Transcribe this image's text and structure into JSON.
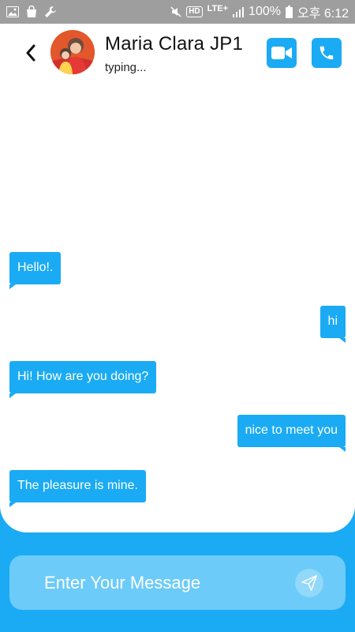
{
  "status_bar": {
    "battery_percent": "100%",
    "time": "오후 6:12",
    "network": "LTE+",
    "hd": "HD",
    "icons": [
      "image-icon",
      "bag-icon",
      "wrench-icon",
      "mute-icon",
      "signal-icon",
      "battery-icon"
    ]
  },
  "header": {
    "back_icon": "chevron-left-icon",
    "contact_name": "Maria Clara JP1",
    "status": "typing...",
    "video_icon": "video-camera-icon",
    "call_icon": "phone-icon"
  },
  "messages": [
    {
      "direction": "in",
      "text": "Hello!."
    },
    {
      "direction": "out",
      "text": "hi"
    },
    {
      "direction": "in",
      "text": "Hi! How are you doing?"
    },
    {
      "direction": "out",
      "text": "nice to meet you"
    },
    {
      "direction": "in",
      "text": "The pleasure is mine."
    }
  ],
  "composer": {
    "placeholder": "Enter Your Message",
    "value": "",
    "send_icon": "send-icon"
  },
  "colors": {
    "accent": "#1aabf4",
    "input_bg": "#6ccbf9",
    "status_bar_bg": "#9e9e9e",
    "card_bg": "#ffffff"
  }
}
